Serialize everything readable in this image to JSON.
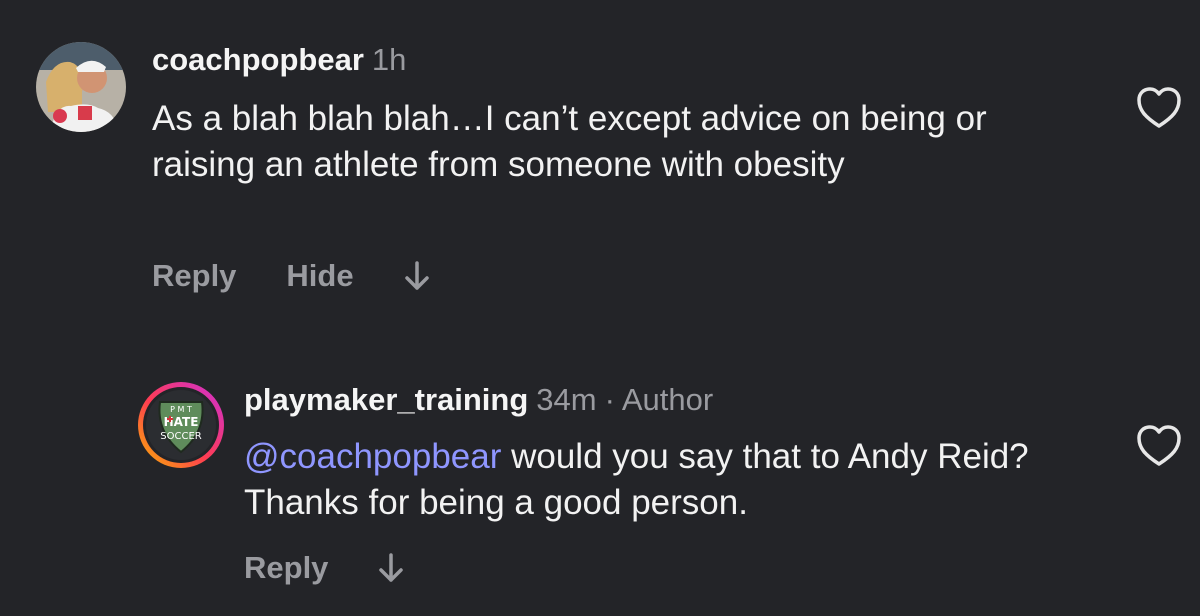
{
  "comments": [
    {
      "username": "coachpopbear",
      "time": "1h",
      "author_tag": "",
      "text": "As a blah blah blah…I can’t except advice on being or raising an athlete from someone with obesity",
      "mention": "",
      "actions": {
        "reply": "Reply",
        "hide": "Hide"
      },
      "icons": [
        "avatar-photo",
        "down-arrow-icon",
        "heart-icon"
      ]
    },
    {
      "username": "playmaker_training",
      "time": "34m",
      "author_tag": "· Author",
      "mention": "@coachpopbear",
      "text": " would you say that to Andy Reid? Thanks for being a good person.",
      "actions": {
        "reply": "Reply"
      },
      "avatar_text": {
        "top": "P M T",
        "middle": "HATE",
        "bottom": "SOCCER"
      },
      "icons": [
        "story-ring-avatar",
        "down-arrow-icon",
        "heart-icon"
      ]
    }
  ],
  "colors": {
    "background": "#232428",
    "mention": "#8f96ff",
    "muted": "#9a9ba0"
  }
}
